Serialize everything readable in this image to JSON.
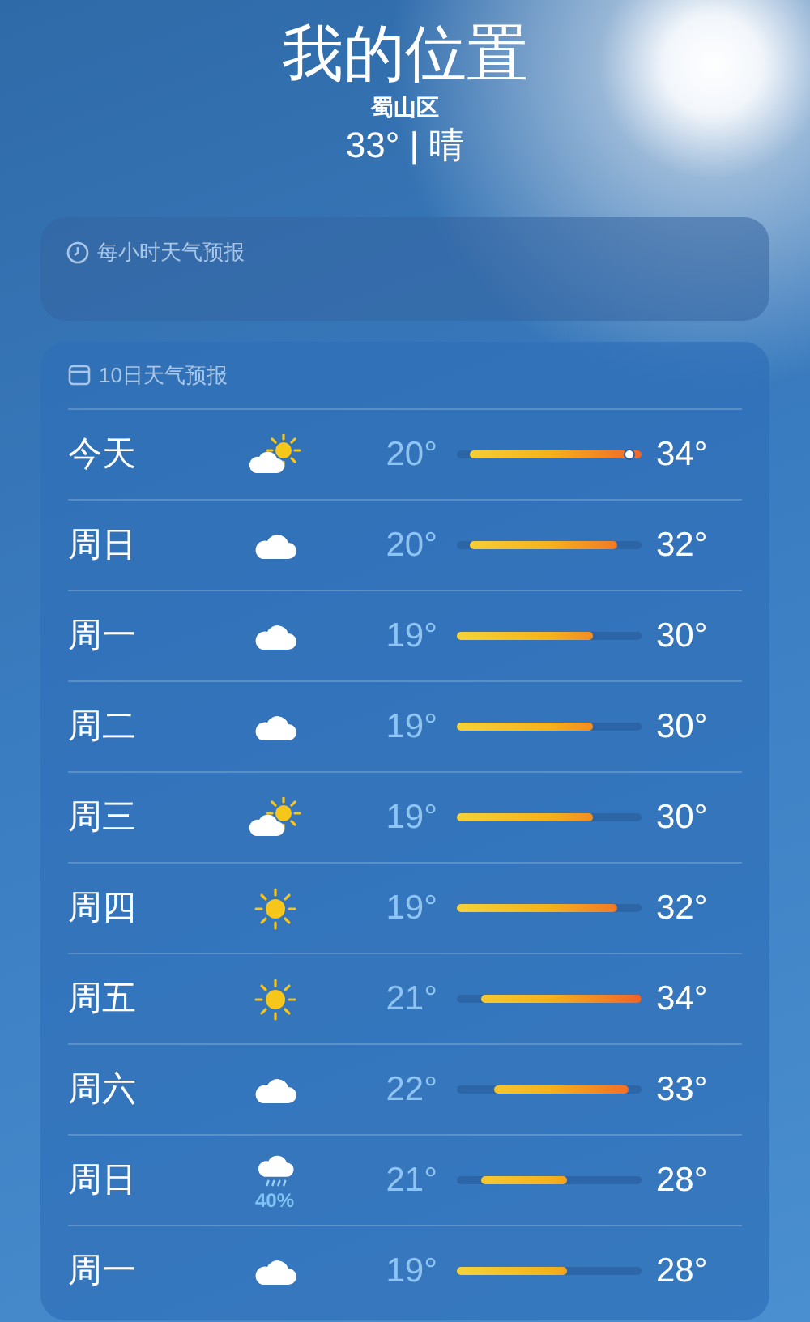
{
  "header": {
    "title": "我的位置",
    "subtitle": "蜀山区",
    "current": "33° | 晴"
  },
  "hourly": {
    "title": "每小时天气预报"
  },
  "daily": {
    "title": "10日天气预报",
    "days": [
      {
        "day": "今天",
        "kind": "partly_cloudy",
        "low": "20°",
        "high": "34°",
        "now": {
          "level": 0.93
        }
      },
      {
        "day": "周日",
        "kind": "cloudy",
        "low": "20°",
        "high": "32°"
      },
      {
        "day": "周一",
        "kind": "cloudy",
        "low": "19°",
        "high": "30°"
      },
      {
        "day": "周二",
        "kind": "cloudy",
        "low": "19°",
        "high": "30°"
      },
      {
        "day": "周三",
        "kind": "partly_cloudy",
        "low": "19°",
        "high": "30°"
      },
      {
        "day": "周四",
        "kind": "sunny",
        "low": "19°",
        "high": "32°"
      },
      {
        "day": "周五",
        "kind": "sunny",
        "low": "21°",
        "high": "34°"
      },
      {
        "day": "周六",
        "kind": "cloudy",
        "low": "22°",
        "high": "33°"
      },
      {
        "day": "周日",
        "kind": "rain",
        "low": "21°",
        "high": "28°",
        "precipitation": "40%"
      },
      {
        "day": "周一",
        "kind": "cloudy",
        "low": "19°",
        "high": "28°"
      }
    ]
  }
}
